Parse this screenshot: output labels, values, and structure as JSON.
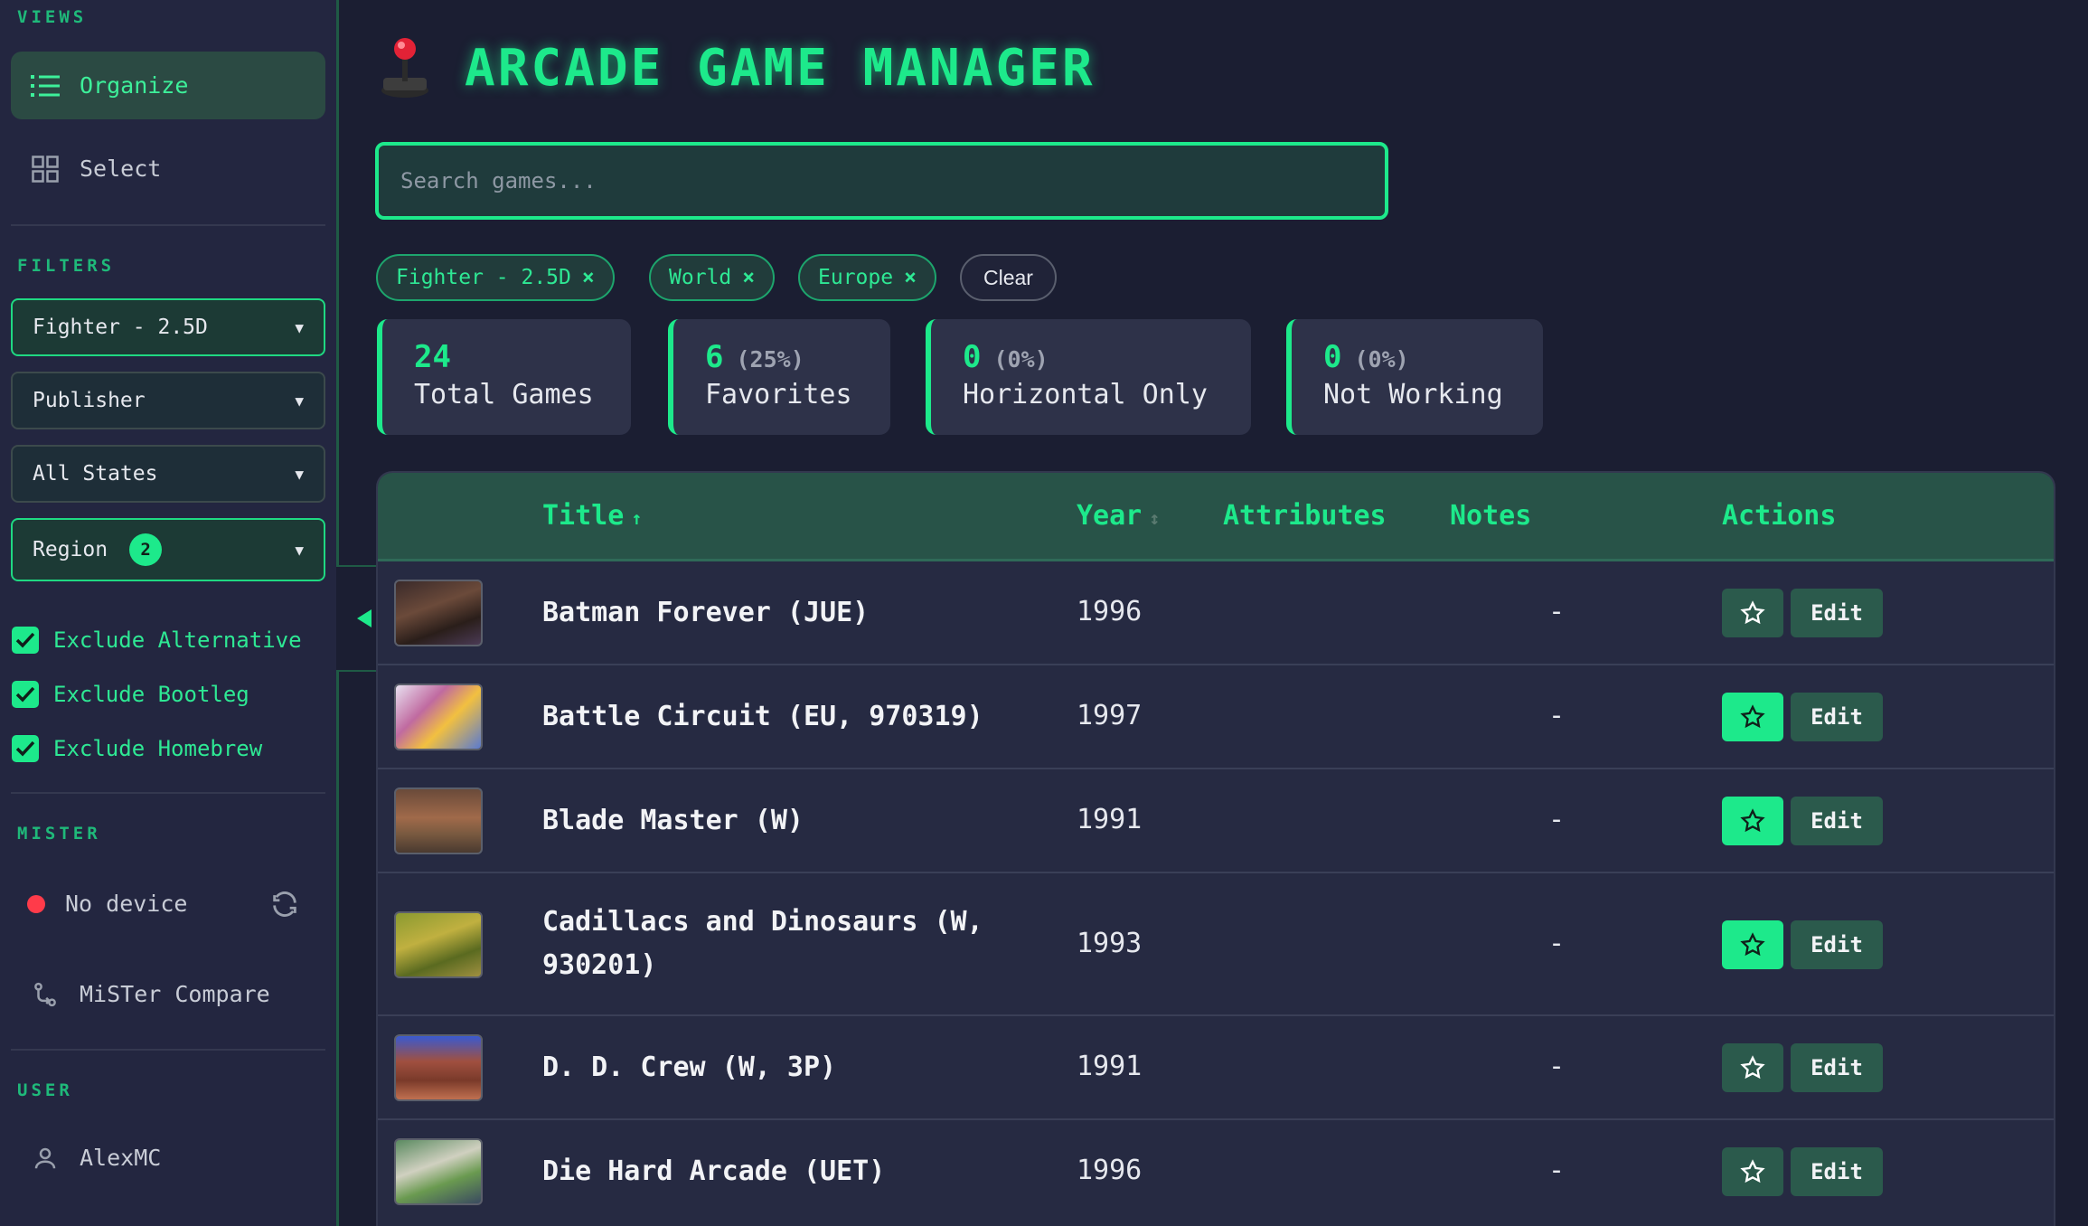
{
  "sidebar": {
    "views_title": "VIEWS",
    "views": [
      {
        "label": "Organize",
        "icon": "list-icon",
        "active": true
      },
      {
        "label": "Select",
        "icon": "grid-icon",
        "active": false
      }
    ],
    "filters_title": "FILTERS",
    "filters": [
      {
        "label": "Fighter - 2.5D",
        "active": true
      },
      {
        "label": "Publisher",
        "active": false
      },
      {
        "label": "All States",
        "active": false
      },
      {
        "label": "Region",
        "active": true,
        "badge": "2"
      }
    ],
    "checks": [
      {
        "label": "Exclude Alternative",
        "checked": true
      },
      {
        "label": "Exclude Bootleg",
        "checked": true
      },
      {
        "label": "Exclude Homebrew",
        "checked": true
      }
    ],
    "mister_title": "MISTER",
    "device_status": "No device",
    "mister_compare": "MiSTer Compare",
    "user_title": "USER",
    "username": "AlexMC"
  },
  "header": {
    "title": "ARCADE GAME MANAGER",
    "search_placeholder": "Search games..."
  },
  "chips": [
    {
      "label": "Fighter - 2.5D",
      "remove": "×"
    },
    {
      "label": "World",
      "remove": "×"
    },
    {
      "label": "Europe",
      "remove": "×"
    }
  ],
  "clear_label": "Clear",
  "stats": [
    {
      "num": "24",
      "pct": "",
      "label": "Total Games"
    },
    {
      "num": "6",
      "pct": "(25%)",
      "label": "Favorites"
    },
    {
      "num": "0",
      "pct": "(0%)",
      "label": "Horizontal Only"
    },
    {
      "num": "0",
      "pct": "(0%)",
      "label": "Not Working"
    }
  ],
  "table": {
    "columns": {
      "title": "Title",
      "title_sort": "↑",
      "year": "Year",
      "year_sort": "↕",
      "attributes": "Attributes",
      "notes": "Notes",
      "actions": "Actions"
    },
    "edit_label": "Edit",
    "rows": [
      {
        "title": "Batman Forever (JUE)",
        "year": "1996",
        "notes": "-",
        "favorite": false
      },
      {
        "title": "Battle Circuit (EU, 970319)",
        "year": "1997",
        "notes": "-",
        "favorite": true
      },
      {
        "title": "Blade Master (W)",
        "year": "1991",
        "notes": "-",
        "favorite": true
      },
      {
        "title": "Cadillacs and Dinosaurs (W, 930201)",
        "year": "1993",
        "notes": "-",
        "favorite": true
      },
      {
        "title": "D. D. Crew (W, 3P)",
        "year": "1991",
        "notes": "-",
        "favorite": false
      },
      {
        "title": "Die Hard Arcade (UET)",
        "year": "1996",
        "notes": "-",
        "favorite": false
      }
    ]
  },
  "colors": {
    "accent": "#1de98b",
    "background": "#1b1e32",
    "sidebar": "#232640",
    "header_row": "#285348",
    "status_red": "#ff3b4a"
  }
}
